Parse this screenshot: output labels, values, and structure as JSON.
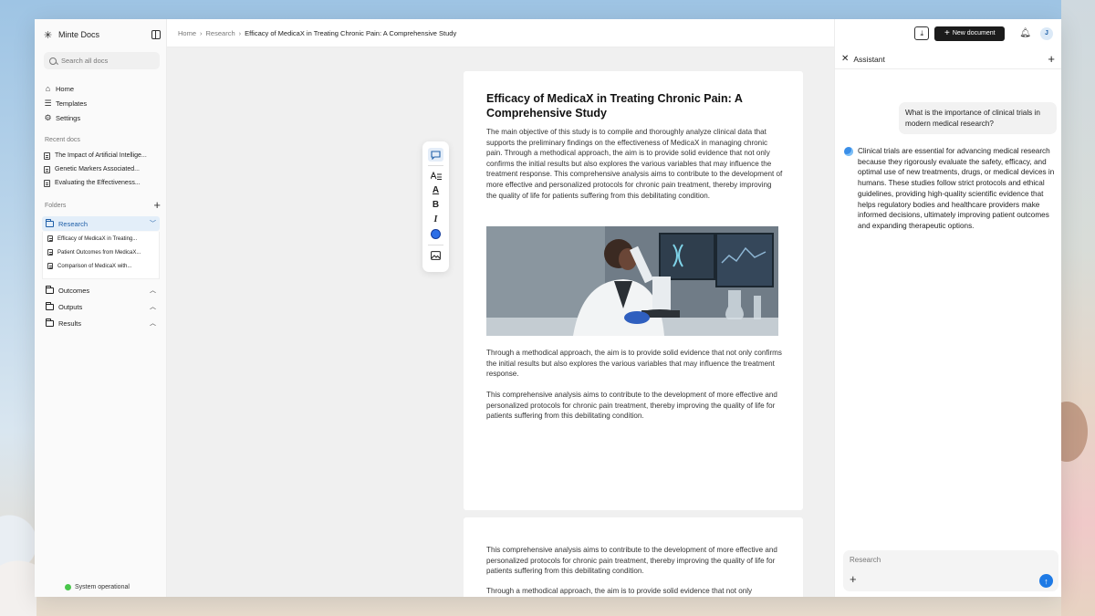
{
  "app": {
    "name": "Minte Docs"
  },
  "sidebar": {
    "search_placeholder": "Search all docs",
    "nav": [
      {
        "label": "Home",
        "icon": "home-icon"
      },
      {
        "label": "Templates",
        "icon": "templates-icon"
      },
      {
        "label": "Settings",
        "icon": "gear-icon"
      }
    ],
    "recent_label": "Recent docs",
    "recent": [
      "The Impact of Artificial Intellige...",
      "Genetic Markers Associated...",
      "Evaluating the Effectiveness..."
    ],
    "folders_label": "Folders",
    "open_folder": {
      "label": "Research",
      "children": [
        "Efficacy of MedicaX in Treating...",
        "Patient Outcomes from MedicaX...",
        "Comparison of MedicaX with..."
      ]
    },
    "folders": [
      "Outcomes",
      "Outputs",
      "Results"
    ],
    "status": "System operational"
  },
  "breadcrumb": {
    "items": [
      "Home",
      "Research"
    ],
    "current": "Efficacy of MedicaX in Treating Chronic Pain: A Comprehensive Study"
  },
  "document": {
    "title": "Efficacy of MedicaX in Treating Chronic Pain: A Comprehensive Study",
    "p1": "The main objective of this study is to compile and thoroughly analyze clinical data that supports the preliminary findings on the effectiveness of MedicaX in managing chronic pain. Through a methodical approach, the aim is to provide solid evidence that not only confirms the initial results but also explores the various variables that may influence the treatment response. This comprehensive analysis aims to contribute to the development of more effective and personalized protocols for chronic pain treatment, thereby improving the quality of life for patients suffering from this debilitating condition.",
    "p2": "Through a methodical approach, the aim is to provide solid evidence that not only confirms the initial results but also explores the various variables that may influence the treatment response.",
    "p3": "This comprehensive analysis aims to contribute to the development of more effective and personalized protocols for chronic pain treatment, thereby improving the quality of life for patients suffering from this debilitating condition.",
    "page2_p1": "This comprehensive analysis aims to contribute to the development of more effective and personalized protocols for chronic pain treatment, thereby improving the quality of life for patients suffering from this debilitating condition.",
    "page2_p2": "Through a methodical approach, the aim is to provide solid evidence that not only"
  },
  "toolbar": {
    "tools": [
      "comment-icon",
      "text-size-icon",
      "text-color-icon",
      "bold-icon",
      "italic-icon",
      "color-picker",
      "insert-image-icon"
    ],
    "bold_glyph": "B",
    "italic_glyph": "I",
    "textcolor_glyph": "A",
    "active_color": "#2c6ee6"
  },
  "topbar": {
    "new_document_label": "New document",
    "avatar_initial": "J"
  },
  "assistant": {
    "title": "Assistant",
    "user_message": "What is the importance of clinical trials in modern medical research?",
    "bot_message": "Clinical trials are essential for advancing medical research because they rigorously evaluate the safety, efficacy, and optimal use of new treatments, drugs, or medical devices in humans. These studies follow strict protocols and ethical guidelines, providing high-quality scientific evidence that helps regulatory bodies and healthcare providers make informed decisions, ultimately improving patient outcomes and expanding therapeutic options.",
    "input_placeholder": "Research"
  }
}
